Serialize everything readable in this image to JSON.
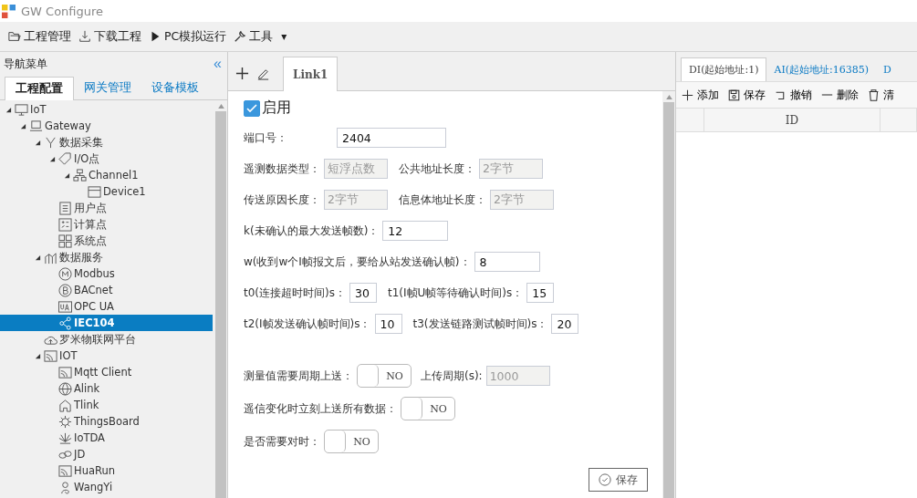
{
  "window": {
    "title": "GW Configure"
  },
  "toolbar": [
    {
      "label": "工程管理"
    },
    {
      "label": "下载工程"
    },
    {
      "label": "PC模拟运行"
    },
    {
      "label": "工具",
      "caret": "▾"
    }
  ],
  "nav": {
    "title": "导航菜单",
    "collapse": "«",
    "tabs": [
      {
        "label": "工程配置",
        "selected": true
      },
      {
        "label": "网关管理",
        "selected": false
      },
      {
        "label": "设备模板",
        "selected": false
      }
    ],
    "tree": [
      {
        "label": "IoT",
        "expanded": true,
        "selected": false,
        "children": [
          {
            "label": "Gateway",
            "expanded": true,
            "selected": false,
            "children": [
              {
                "label": "数据采集",
                "expanded": true,
                "selected": false,
                "children": [
                  {
                    "label": "I/O点",
                    "expanded": true,
                    "selected": false,
                    "children": [
                      {
                        "label": "Channel1",
                        "expanded": true,
                        "selected": false,
                        "children": [
                          {
                            "label": "Device1",
                            "selected": false
                          }
                        ]
                      }
                    ]
                  },
                  {
                    "label": "用户点",
                    "selected": false
                  },
                  {
                    "label": "计算点",
                    "selected": false
                  },
                  {
                    "label": "系统点",
                    "selected": false
                  }
                ]
              },
              {
                "label": "数据服务",
                "expanded": true,
                "selected": false,
                "children": [
                  {
                    "label": "Modbus",
                    "selected": false
                  },
                  {
                    "label": "BACnet",
                    "selected": false
                  },
                  {
                    "label": "OPC UA",
                    "selected": false
                  },
                  {
                    "label": "IEC104",
                    "selected": true
                  }
                ]
              },
              {
                "label": "罗米物联网平台",
                "selected": false
              },
              {
                "label": "IOT",
                "expanded": true,
                "selected": false,
                "children": [
                  {
                    "label": "Mqtt Client",
                    "selected": false
                  },
                  {
                    "label": "Alink",
                    "selected": false
                  },
                  {
                    "label": "Tlink",
                    "selected": false
                  },
                  {
                    "label": "ThingsBoard",
                    "selected": false
                  },
                  {
                    "label": "IoTDA",
                    "selected": false
                  },
                  {
                    "label": "JD",
                    "selected": false
                  },
                  {
                    "label": "HuaRun",
                    "selected": false
                  },
                  {
                    "label": "WangYi",
                    "selected": false
                  }
                ]
              }
            ]
          }
        ]
      }
    ]
  },
  "editor": {
    "tabs": [
      {
        "label": "Link1",
        "selected": true
      }
    ],
    "enable": {
      "label": "启用",
      "checked": true
    },
    "rows": [
      {
        "items": [
          {
            "kind": "input",
            "label": "端口号：",
            "value": "2404",
            "disabled": false
          }
        ]
      },
      {
        "items": [
          {
            "kind": "input",
            "label": "遥测数据类型：",
            "value": "短浮点数",
            "disabled": true
          },
          {
            "kind": "input",
            "label": "公共地址长度：",
            "value": "2字节",
            "disabled": true
          }
        ]
      },
      {
        "items": [
          {
            "kind": "input",
            "label": "传送原因长度：",
            "value": "2字节",
            "disabled": true
          },
          {
            "kind": "input",
            "label": "信息体地址长度：",
            "value": "2字节",
            "disabled": true
          }
        ]
      },
      {
        "items": [
          {
            "kind": "input",
            "label": "k(未确认的最大发送帧数)：",
            "value": "12",
            "disabled": false
          }
        ]
      },
      {
        "items": [
          {
            "kind": "input",
            "label": "w(收到w个I帧报文后，要给从站发送确认帧)：",
            "value": "8",
            "disabled": false
          }
        ]
      },
      {
        "items": [
          {
            "kind": "small",
            "label": "t0(连接超时时间)s：",
            "value": "30",
            "disabled": false
          },
          {
            "kind": "small",
            "label": "t1(I帧U帧等待确认时间)s：",
            "value": "15",
            "disabled": false
          }
        ]
      },
      {
        "items": [
          {
            "kind": "small",
            "label": "t2(I帧发送确认帧时间)s：",
            "value": "10",
            "disabled": false
          },
          {
            "kind": "small",
            "label": "t3(发送链路测试帧时间)s：",
            "value": "20",
            "disabled": false
          }
        ]
      }
    ],
    "switch_rows": [
      {
        "items": [
          {
            "kind": "toggle",
            "label": "测量值需要周期上送：",
            "on": false,
            "text": "NO"
          },
          {
            "kind": "input",
            "label": "上传周期(s):",
            "value": "1000",
            "disabled": true
          }
        ]
      },
      {
        "items": [
          {
            "kind": "toggle",
            "label": "遥信变化时立刻上送所有数据：",
            "on": false,
            "text": "NO"
          }
        ]
      },
      {
        "items": [
          {
            "kind": "toggle",
            "label": "是否需要对时：",
            "on": false,
            "text": "NO"
          }
        ]
      }
    ],
    "save_button": "保存"
  },
  "points": {
    "tabs": [
      {
        "label": "DI(起始地址:1)",
        "selected": true
      },
      {
        "label": "AI(起始地址:16385)",
        "selected": false
      },
      {
        "label": "D",
        "selected": false
      }
    ],
    "actions": [
      {
        "label": "添加"
      },
      {
        "label": "保存"
      },
      {
        "label": "撤销"
      },
      {
        "label": "删除"
      },
      {
        "label": "清"
      }
    ],
    "columns": [
      "",
      "ID",
      ""
    ]
  }
}
